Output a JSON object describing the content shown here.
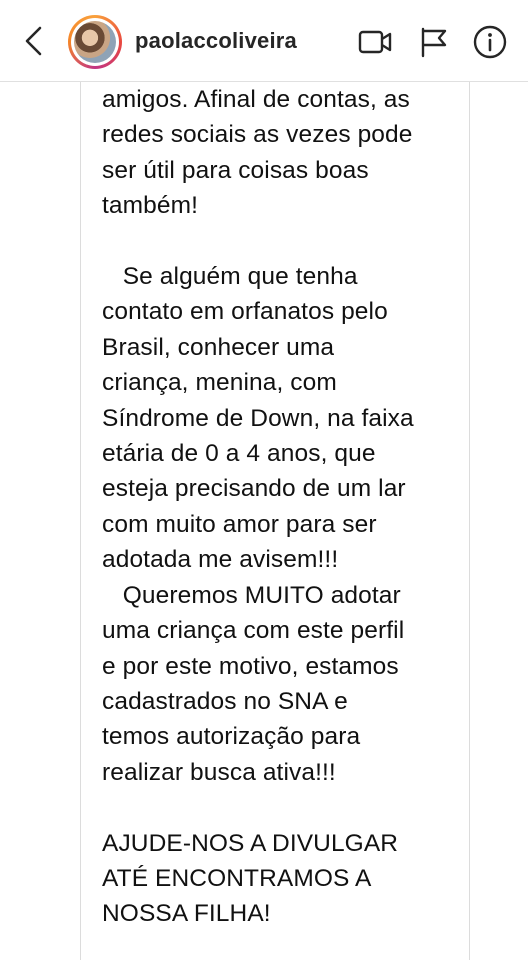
{
  "header": {
    "username": "paolaccoliveira"
  },
  "post": {
    "lines": [
      "amigos. Afinal de contas, as",
      "redes sociais as vezes pode",
      "ser útil para coisas boas",
      "também!",
      "",
      "   Se alguém que tenha",
      "contato em orfanatos pelo",
      "Brasil, conhecer uma",
      "criança, menina, com",
      "Síndrome de Down, na faixa",
      "etária de 0 a 4 anos, que",
      "esteja precisando de um lar",
      "com muito amor para ser",
      "adotada me avisem!!!",
      "   Queremos MUITO adotar",
      "uma criança com este perfil",
      "e por este motivo, estamos",
      "cadastrados no SNA e",
      "temos autorização para",
      "realizar busca ativa!!!",
      "",
      "AJUDE-NOS A DIVULGAR",
      "ATÉ ENCONTRAMOS A",
      "NOSSA FILHA!"
    ]
  },
  "icons": {
    "back": "chevron-left-icon",
    "video": "video-camera-icon",
    "flag": "flag-icon",
    "info": "info-icon"
  }
}
